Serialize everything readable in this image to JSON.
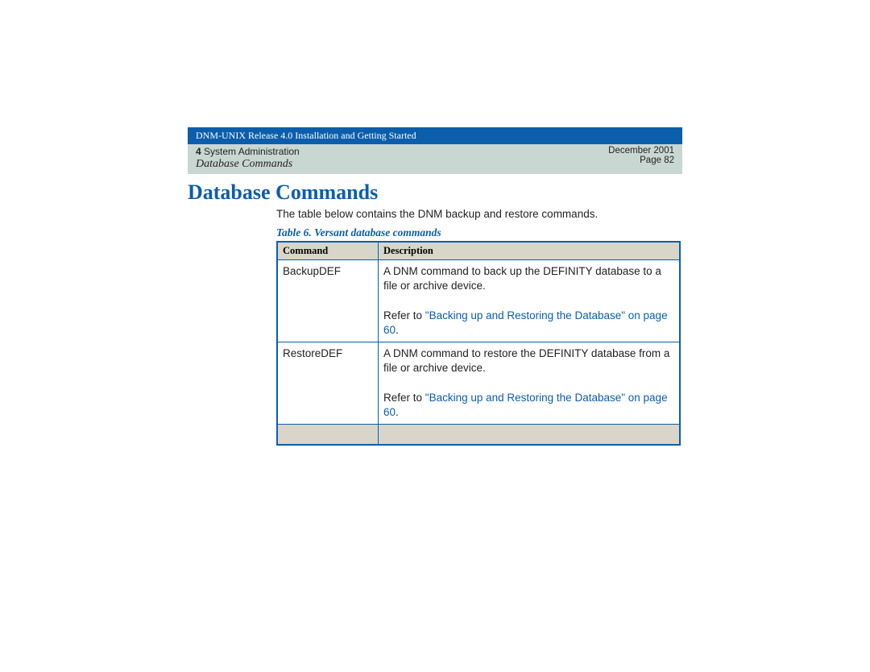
{
  "header": {
    "doc_title": "DNM-UNIX Release 4.0 Installation and Getting Started",
    "chapter_num": "4",
    "chapter_title": " System Administration",
    "section": "Database Commands",
    "date": "December 2001",
    "page": "Page 82"
  },
  "main": {
    "heading": "Database Commands",
    "intro": "The table below contains the DNM backup and restore commands.",
    "table_caption": "Table 6.  Versant database commands",
    "columns": {
      "command": "Command",
      "description": "Description"
    },
    "rows": [
      {
        "command": "BackupDEF",
        "desc_line1": "A DNM command to back up the DEFINITY database to a file or archive device.",
        "refer_prefix": "Refer to ",
        "refer_link": "\"Backing up and Restoring the Database\" on page 60",
        "refer_suffix": "."
      },
      {
        "command": "RestoreDEF",
        "desc_line1": "A DNM command to restore the DEFINITY database from a file or archive device.",
        "refer_prefix": "Refer to ",
        "refer_link": "\"Backing up and Restoring the Database\" on page 60",
        "refer_suffix": "."
      }
    ]
  }
}
